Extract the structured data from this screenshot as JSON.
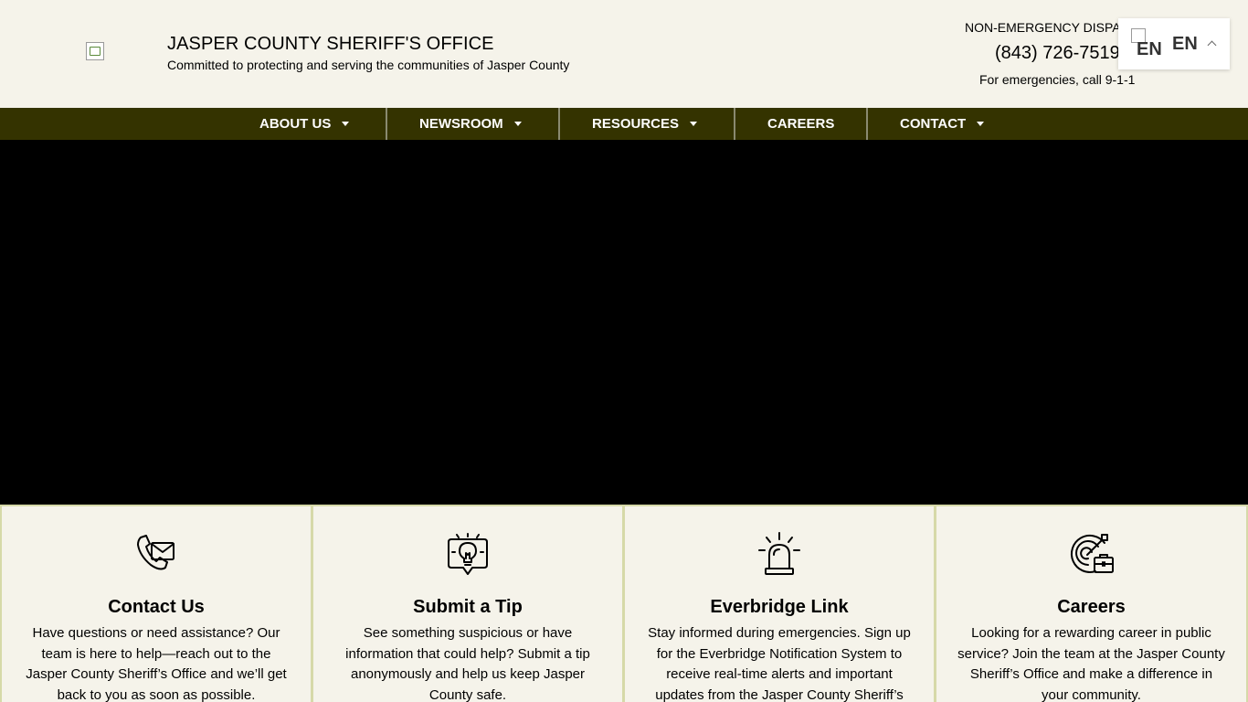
{
  "header": {
    "title": "JASPER COUNTY SHERIFF'S OFFICE",
    "tagline": "Committed to protecting and serving the communities of Jasper County",
    "dispatch_label": "NON-EMERGENCY DISPATCH",
    "dispatch_phone": "(843) 726-7519",
    "emergency_note": "For emergencies, call 9-1-1"
  },
  "language": {
    "flag_alt": "EN",
    "label": "EN"
  },
  "nav": {
    "items": [
      {
        "label": "ABOUT US"
      },
      {
        "label": "NEWSROOM"
      },
      {
        "label": "RESOURCES"
      },
      {
        "label": "CAREERS"
      },
      {
        "label": "CONTACT"
      }
    ]
  },
  "cards": [
    {
      "icon": "phone-email-icon",
      "title": "Contact Us",
      "text": "Have questions or need assistance? Our team is here to help—reach out to the Jasper County Sheriff’s Office and we’ll get back to you as soon as possible."
    },
    {
      "icon": "lightbulb-tip-icon",
      "title": "Submit a Tip",
      "text": "See something suspicious or have information that could help? Submit a tip anonymously and help us keep Jasper County safe."
    },
    {
      "icon": "siren-icon",
      "title": "Everbridge Link",
      "text": "Stay informed during emergencies. Sign up for the Everbridge Notification System to receive real-time alerts and important updates from the Jasper County Sheriff’s"
    },
    {
      "icon": "target-briefcase-icon",
      "title": "Careers",
      "text": "Looking for a rewarding career in public service? Join the team at the Jasper County Sheriff’s Office and make a difference in your community."
    }
  ],
  "colors": {
    "background": "#f5f3ea",
    "nav_background": "#343300",
    "card_border": "#d6d9a8",
    "hero": "#000000"
  }
}
